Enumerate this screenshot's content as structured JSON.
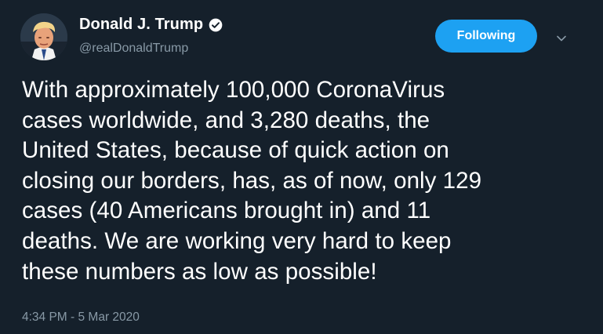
{
  "author": {
    "display_name": "Donald J. Trump",
    "handle": "@realDonaldTrump",
    "verified": true,
    "avatar_icon": "profile-photo"
  },
  "actions": {
    "follow_label": "Following",
    "more_icon": "chevron-down-icon"
  },
  "tweet": {
    "text": "With approximately 100,000 CoronaVirus\ncases worldwide, and 3,280 deaths, the\nUnited States, because of quick action on\nclosing our borders, has, as of now, only 129\ncases (40 Americans brought in) and 11\ndeaths. We are working very hard to keep\nthese numbers as low as possible!",
    "timestamp": "4:34 PM - 5 Mar 2020"
  },
  "colors": {
    "background": "#15202b",
    "text_primary": "#ffffff",
    "text_secondary": "#8899a6",
    "accent": "#1da1f2"
  }
}
